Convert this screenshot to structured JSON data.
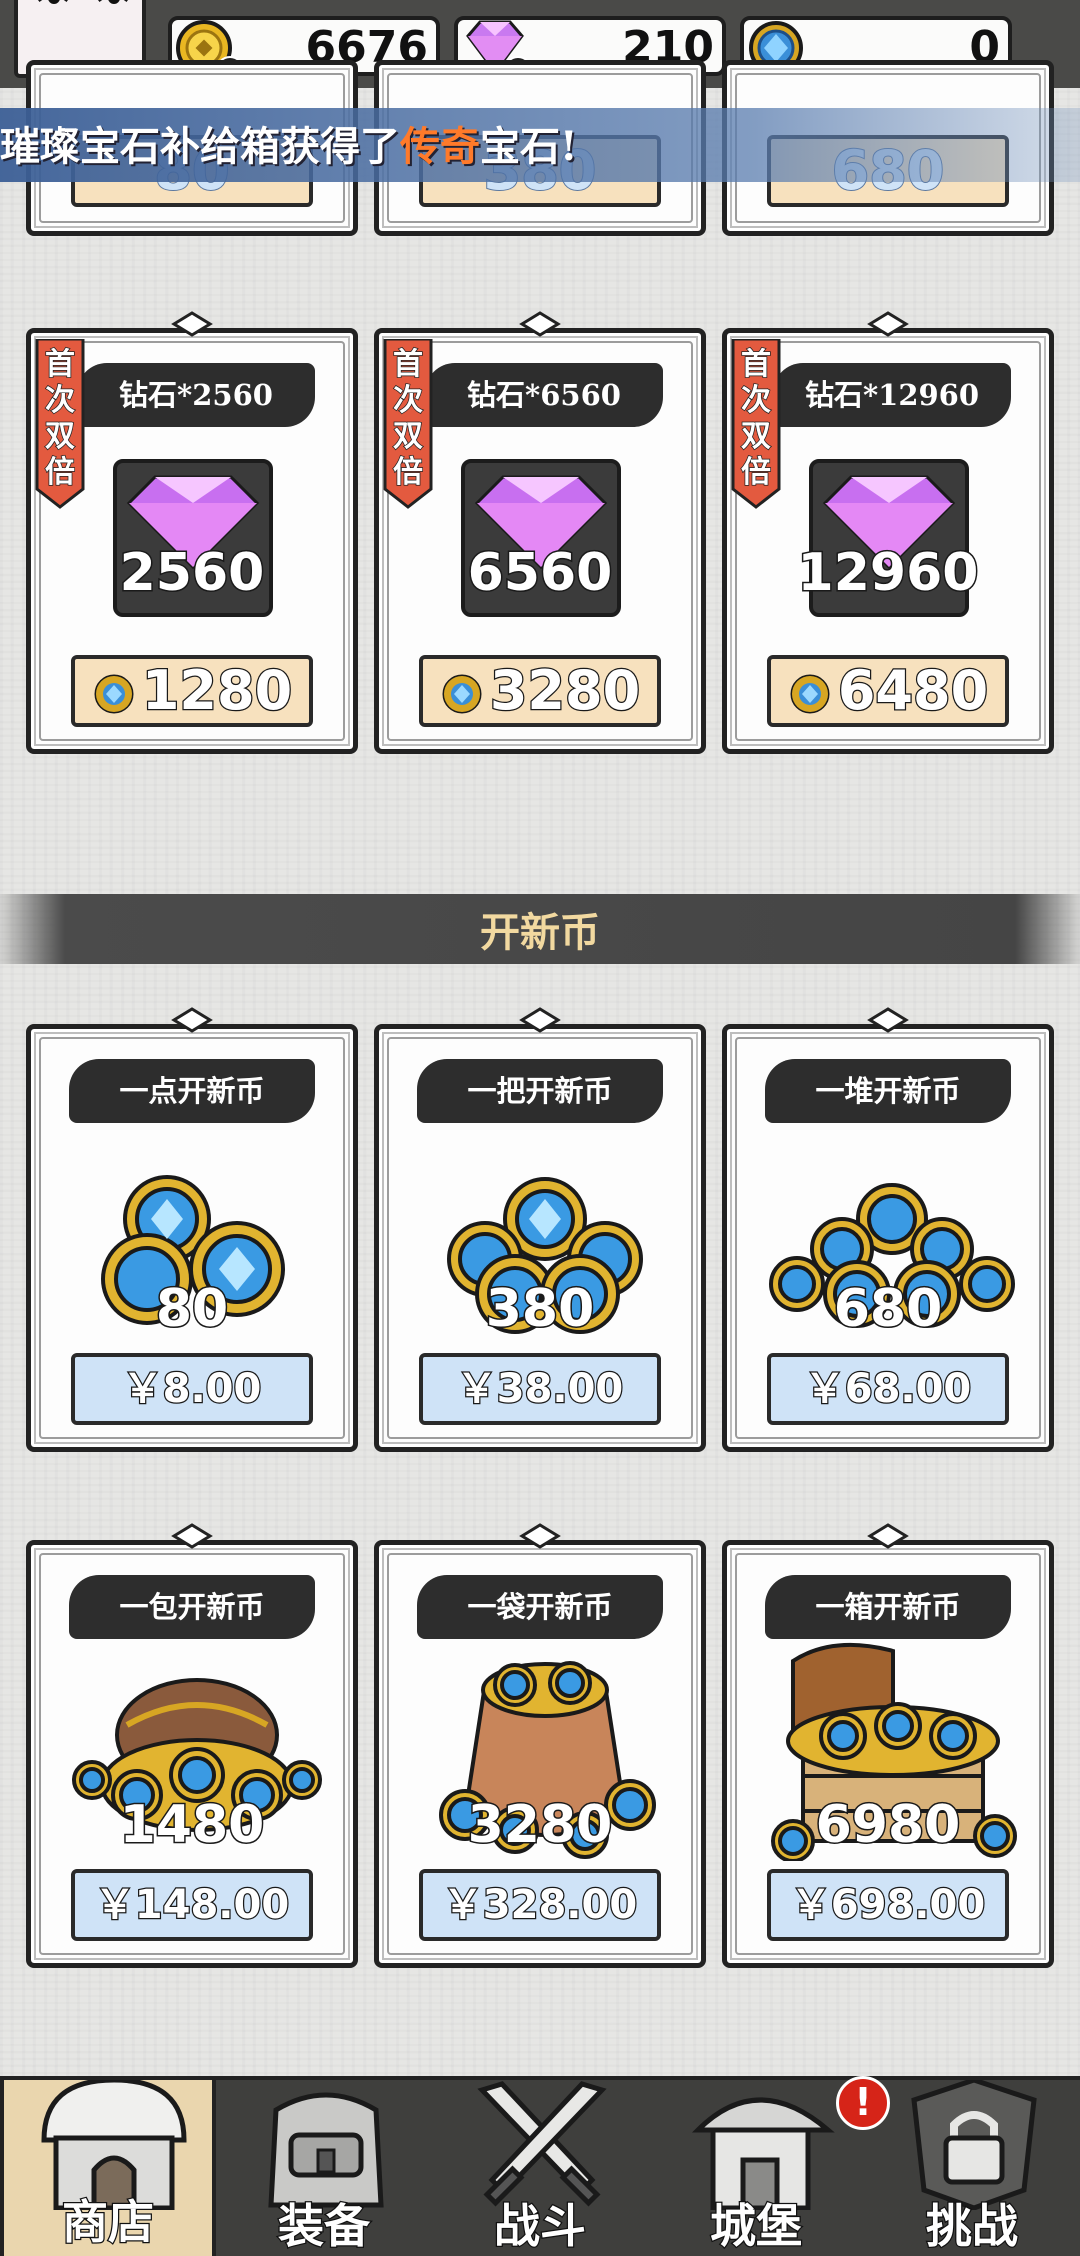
{
  "currencies": {
    "gold": {
      "value": "6676",
      "icon": "gold-coin-icon"
    },
    "diamond": {
      "value": "210",
      "icon": "purple-diamond-icon"
    },
    "kaixin_coin": {
      "value": "0",
      "icon": "blue-gem-coin-icon"
    }
  },
  "marquee": {
    "prefix": "璀璨宝石补给箱获得了",
    "highlight": "传奇",
    "suffix": "宝石!"
  },
  "partial_row": {
    "amounts": [
      "80",
      "380",
      "680"
    ]
  },
  "diamond_packs": [
    {
      "ribbon": [
        "首",
        "次",
        "双",
        "倍"
      ],
      "title": "钻石*2560",
      "amount": "2560",
      "price": "1280"
    },
    {
      "ribbon": [
        "首",
        "次",
        "双",
        "倍"
      ],
      "title": "钻石*6560",
      "amount": "6560",
      "price": "3280"
    },
    {
      "ribbon": [
        "首",
        "次",
        "双",
        "倍"
      ],
      "title": "钻石*12960",
      "amount": "12960",
      "price": "6480"
    }
  ],
  "section": {
    "title": "开新币"
  },
  "coin_packs": [
    {
      "title": "一点开新币",
      "amount": "80",
      "price": "￥8.00",
      "icon": "small-coin-pile-icon"
    },
    {
      "title": "一把开新币",
      "amount": "380",
      "price": "￥38.00",
      "icon": "coin-handful-icon"
    },
    {
      "title": "一堆开新币",
      "amount": "680",
      "price": "￥68.00",
      "icon": "coin-heap-icon"
    },
    {
      "title": "一包开新币",
      "amount": "1480",
      "price": "￥148.00",
      "icon": "coin-pouch-icon"
    },
    {
      "title": "一袋开新币",
      "amount": "3280",
      "price": "￥328.00",
      "icon": "coin-sack-icon"
    },
    {
      "title": "一箱开新币",
      "amount": "6980",
      "price": "￥698.00",
      "icon": "treasure-chest-icon"
    }
  ],
  "nav": {
    "items": [
      {
        "label": "商店",
        "icon": "shop-icon",
        "active": true
      },
      {
        "label": "装备",
        "icon": "backpack-icon",
        "active": false
      },
      {
        "label": "战斗",
        "icon": "crossed-swords-icon",
        "active": false
      },
      {
        "label": "城堡",
        "icon": "castle-icon",
        "active": false
      },
      {
        "label": "挑战",
        "icon": "locked-challenge-icon",
        "active": false
      }
    ],
    "alert": "!"
  }
}
